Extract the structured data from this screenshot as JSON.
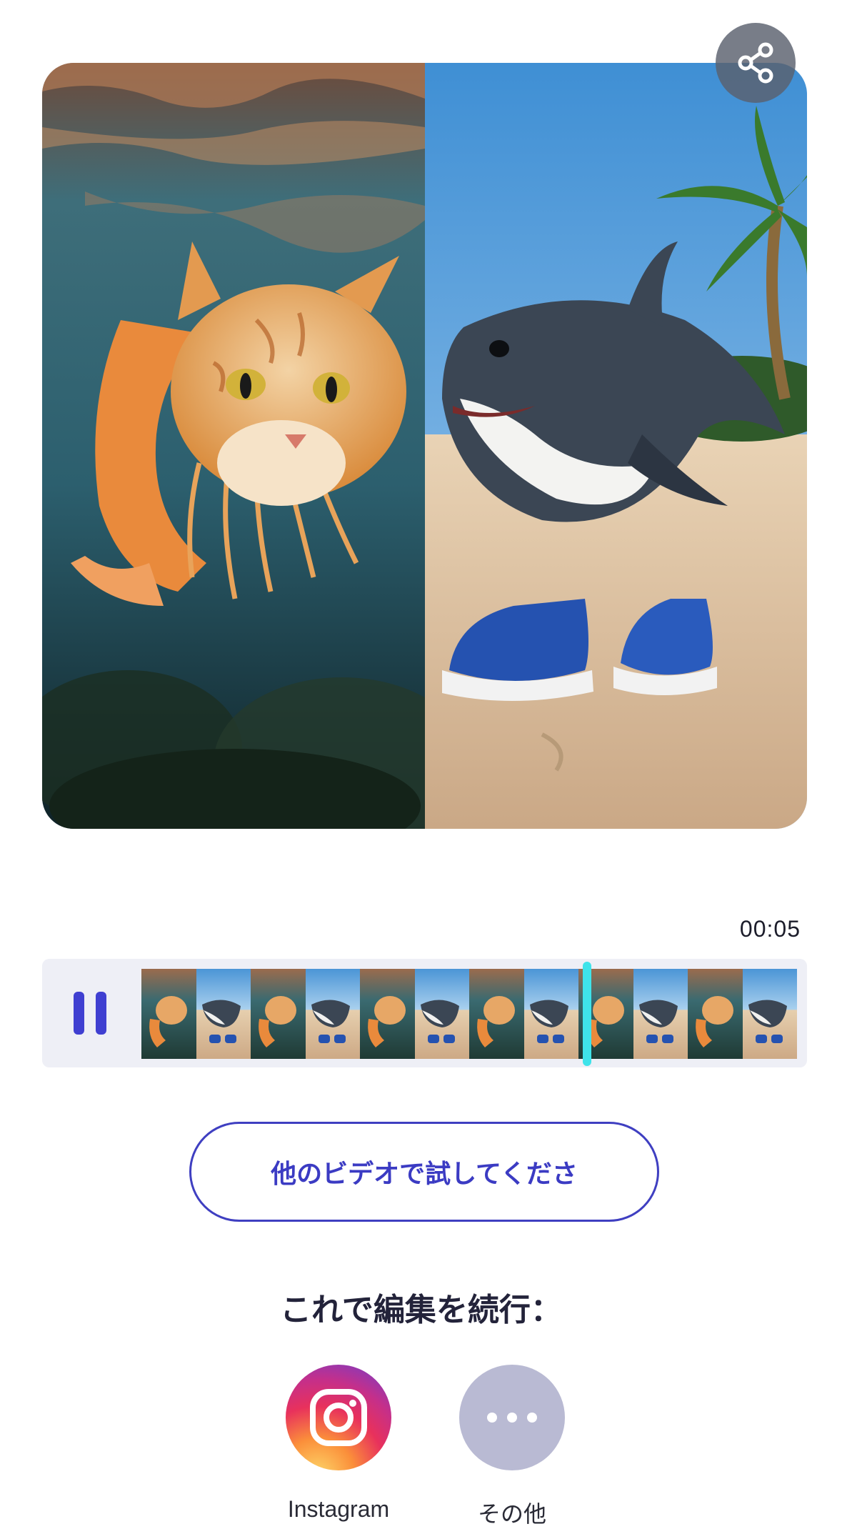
{
  "preview": {
    "left_image": "cat-shrimp-underwater",
    "right_image": "shark-in-sneakers-beach"
  },
  "share_icon": "share-icon",
  "player": {
    "time": "00:05",
    "progress": 0.68,
    "state": "playing",
    "pause_icon": "pause-icon",
    "frame_count": 12
  },
  "actions": {
    "try_other_video": "他のビデオで試してくださ"
  },
  "continue": {
    "title": "これで編集を続行：",
    "apps": [
      {
        "label": "Instagram",
        "icon": "instagram-icon"
      },
      {
        "label": "その他",
        "icon": "more-dots-icon"
      }
    ]
  },
  "colors": {
    "accent": "#3f3fd1",
    "playhead": "#3fe3ea",
    "timeline_bg": "#eeeff6"
  }
}
